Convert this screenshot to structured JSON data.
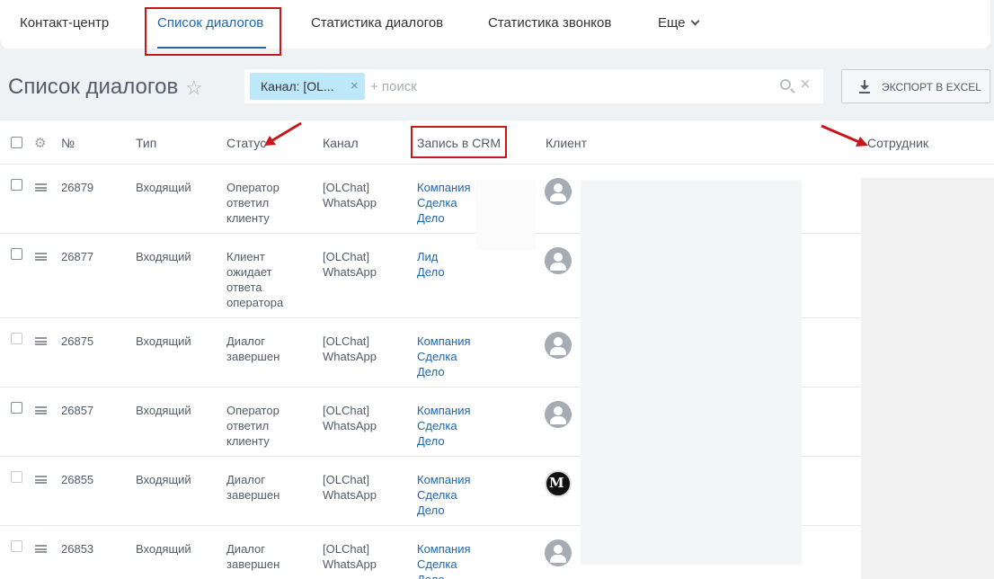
{
  "topnav": {
    "items": [
      {
        "label": "Контакт-центр"
      },
      {
        "label": "Список диалогов"
      },
      {
        "label": "Статистика диалогов"
      },
      {
        "label": "Статистика звонков"
      },
      {
        "label": "Еще"
      }
    ]
  },
  "page": {
    "title": "Список диалогов",
    "star_glyph": "☆"
  },
  "filter": {
    "chip_label": "Канал: [OL...",
    "chip_close": "×",
    "search_placeholder": "+ поиск",
    "clear_glyph": "×"
  },
  "export_button": {
    "label": "ЭКСПОРТ В EXCEL"
  },
  "table": {
    "settings_glyph": "⚙",
    "headers": {
      "number": "№",
      "type": "Тип",
      "status": "Статус",
      "channel": "Канал",
      "crm": "Запись в CRM",
      "client": "Клиент",
      "employee": "Сотрудник"
    },
    "rows": [
      {
        "number": "26879",
        "type": "Входящий",
        "status": "Оператор\nответил\nклиенту",
        "channel": "[OLChat]\nWhatsApp",
        "crm": [
          "Компания",
          "Сделка",
          "Дело"
        ],
        "checkbox_style": "dark",
        "avatar": "person"
      },
      {
        "number": "26877",
        "type": "Входящий",
        "status": "Клиент\nожидает\nответа\nоператора",
        "channel": "[OLChat]\nWhatsApp",
        "crm": [
          "Лид",
          "Дело"
        ],
        "checkbox_style": "dark",
        "avatar": "person"
      },
      {
        "number": "26875",
        "type": "Входящий",
        "status": "Диалог\nзавершен",
        "channel": "[OLChat]\nWhatsApp",
        "crm": [
          "Компания",
          "Сделка",
          "Дело"
        ],
        "checkbox_style": "light",
        "avatar": "person"
      },
      {
        "number": "26857",
        "type": "Входящий",
        "status": "Оператор\nответил\nклиенту",
        "channel": "[OLChat]\nWhatsApp",
        "crm": [
          "Компания",
          "Сделка",
          "Дело"
        ],
        "checkbox_style": "dark",
        "avatar": "person"
      },
      {
        "number": "26855",
        "type": "Входящий",
        "status": "Диалог\nзавершен",
        "channel": "[OLChat]\nWhatsApp",
        "crm": [
          "Компания",
          "Сделка",
          "Дело"
        ],
        "checkbox_style": "light",
        "avatar": "logo"
      },
      {
        "number": "26853",
        "type": "Входящий",
        "status": "Диалог\nзавершен",
        "channel": "[OLChat]\nWhatsApp",
        "crm": [
          "Компания",
          "Сделка",
          "Дело"
        ],
        "checkbox_style": "light",
        "avatar": "person"
      }
    ]
  },
  "colors": {
    "accent": "#2067b0",
    "annotation_red": "#c8161d",
    "chip": "#bde8fa"
  }
}
